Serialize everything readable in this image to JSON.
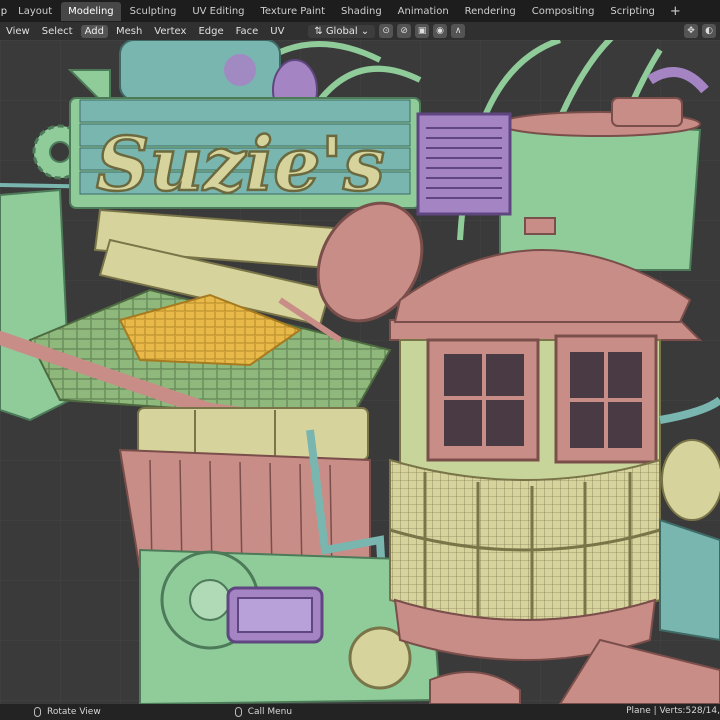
{
  "topbar": {
    "menu_fragment": "lp",
    "tabs": [
      {
        "label": "Layout",
        "active": false
      },
      {
        "label": "Modeling",
        "active": true
      },
      {
        "label": "Sculpting",
        "active": false
      },
      {
        "label": "UV Editing",
        "active": false
      },
      {
        "label": "Texture Paint",
        "active": false
      },
      {
        "label": "Shading",
        "active": false
      },
      {
        "label": "Animation",
        "active": false
      },
      {
        "label": "Rendering",
        "active": false
      },
      {
        "label": "Compositing",
        "active": false
      },
      {
        "label": "Scripting",
        "active": false
      }
    ],
    "add_tab": "+"
  },
  "header": {
    "menus": {
      "view": "View",
      "select": "Select",
      "add": "Add",
      "mesh": "Mesh",
      "vertex": "Vertex",
      "edge": "Edge",
      "face": "Face",
      "uv": "UV"
    },
    "orientation": "Global"
  },
  "scene": {
    "sign_text": "Suzie's"
  },
  "statusbar": {
    "rotate_view": "Rotate View",
    "call_menu": "Call Menu",
    "stats": "Plane | Verts:528/14,"
  },
  "colors": {
    "mint": "#8fcc9a",
    "teal": "#79b6b0",
    "pink": "#c98d87",
    "purple": "#a584c4",
    "sand": "#d7d39c",
    "yellow": "#e8b848"
  }
}
